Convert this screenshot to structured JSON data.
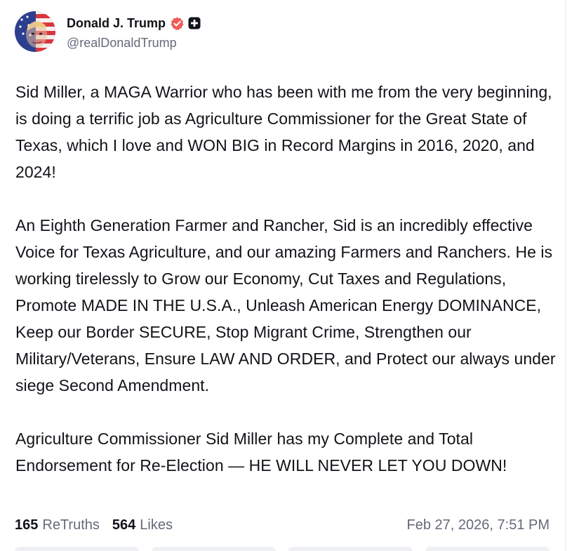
{
  "post": {
    "author": {
      "display_name": "Donald J. Trump",
      "handle": "@realDonaldTrump",
      "verified_icon": "verified-badge-icon",
      "badge_icon": "plus-badge-icon"
    },
    "paragraphs": [
      "Sid Miller, a MAGA Warrior who has been with me from the very beginning, is doing a terrific job as Agriculture Commissioner for the Great State of Texas, which I love and WON BIG in Record Margins in 2016, 2020, and 2024!",
      "An Eighth Generation Farmer and Rancher, Sid is an incredibly effective Voice for Texas Agriculture, and our amazing Farmers and Ranchers. He is working tirelessly to Grow our Economy, Cut Taxes and Regulations, Promote MADE IN THE U.S.A., Unleash American Energy DOMINANCE, Keep our Border SECURE, Stop Migrant Crime, Strengthen our Military/Veterans, Ensure LAW AND ORDER, and Protect our always under siege Second Amendment.",
      "Agriculture Commissioner Sid Miller has my Complete and Total Endorsement for Re-Election — HE WILL NEVER LET YOU DOWN!"
    ],
    "stats": {
      "retruths_count": "165",
      "retruths_label": "ReTruths",
      "likes_count": "564",
      "likes_label": "Likes"
    },
    "timestamp": "Feb 27, 2026, 7:51 PM"
  },
  "colors": {
    "verified_badge": "#f15a5a",
    "text_primary": "#111318",
    "text_secondary": "#656a7a"
  }
}
